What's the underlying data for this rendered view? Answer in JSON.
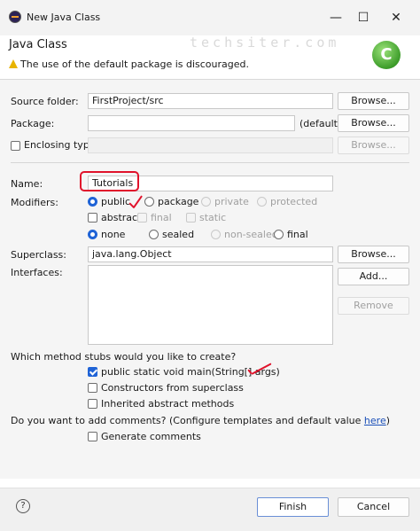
{
  "window": {
    "title": "New Java Class",
    "minimize_glyph": "—",
    "maximize_glyph": "☐",
    "close_glyph": "✕"
  },
  "header": {
    "title": "Java Class",
    "warning": "The use of the default package is discouraged.",
    "watermark": "techsiter.com",
    "logo_letter": "C"
  },
  "form": {
    "source_folder": {
      "label": "Source folder:",
      "value": "FirstProject/src",
      "browse": "Browse..."
    },
    "package": {
      "label": "Package:",
      "value": "",
      "hint": "(default)",
      "browse": "Browse..."
    },
    "enclosing_type": {
      "label": "Enclosing type:",
      "value": "",
      "browse": "Browse..."
    },
    "name": {
      "label": "Name:",
      "value": "Tutorials"
    },
    "modifiers": {
      "label": "Modifiers:",
      "access": [
        "public",
        "package",
        "private",
        "protected"
      ],
      "access_selected": "public",
      "flags": [
        "abstract",
        "final",
        "static"
      ],
      "sealing": [
        "none",
        "sealed",
        "non-sealed",
        "final"
      ],
      "sealing_selected": "none"
    },
    "superclass": {
      "label": "Superclass:",
      "value": "java.lang.Object",
      "browse": "Browse..."
    },
    "interfaces": {
      "label": "Interfaces:",
      "add": "Add...",
      "remove": "Remove"
    },
    "stubs": {
      "question": "Which method stubs would you like to create?",
      "options": [
        {
          "label": "public static void main(String[] args)",
          "checked": true
        },
        {
          "label": "Constructors from superclass",
          "checked": false
        },
        {
          "label": "Inherited abstract methods",
          "checked": false
        }
      ]
    },
    "comments": {
      "question": "Do you want to add comments? (Configure templates and default value ",
      "link": "here",
      "close_paren": ")",
      "option": "Generate comments"
    }
  },
  "footer": {
    "help_glyph": "?",
    "finish": "Finish",
    "cancel": "Cancel"
  },
  "colors": {
    "accent": "#1f63d6",
    "annotation": "#e0122b",
    "link": "#1a4fb8"
  }
}
